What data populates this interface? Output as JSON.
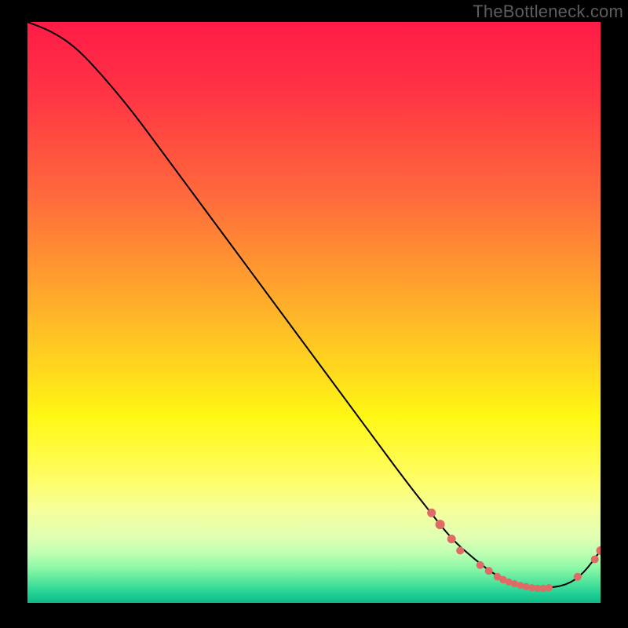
{
  "watermark": "TheBottleneck.com",
  "chart_data": {
    "type": "line",
    "title": "",
    "xlabel": "",
    "ylabel": "",
    "xlim": [
      0,
      100
    ],
    "ylim": [
      0,
      100
    ],
    "grid": false,
    "series": [
      {
        "name": "curve",
        "x": [
          0,
          4,
          8,
          12,
          18,
          24,
          30,
          36,
          42,
          48,
          54,
          60,
          66,
          70,
          74,
          78,
          82,
          86,
          90,
          94,
          97,
          100
        ],
        "y": [
          100,
          98.5,
          96,
          92,
          85,
          77,
          69,
          61,
          53,
          45,
          37,
          29,
          21,
          16,
          11,
          7.5,
          4.5,
          3,
          2.5,
          3,
          5,
          9
        ]
      }
    ],
    "markers": {
      "name": "highlight-dots",
      "color": "#e06a65",
      "points": [
        {
          "x": 70.5,
          "y": 15.5,
          "r": 5.5
        },
        {
          "x": 72.0,
          "y": 13.5,
          "r": 6.0
        },
        {
          "x": 74.0,
          "y": 11.0,
          "r": 5.5
        },
        {
          "x": 75.5,
          "y": 9.0,
          "r": 5.0
        },
        {
          "x": 79.0,
          "y": 6.5,
          "r": 5.0
        },
        {
          "x": 80.5,
          "y": 5.5,
          "r": 5.0
        },
        {
          "x": 82.0,
          "y": 4.5,
          "r": 4.8
        },
        {
          "x": 83.0,
          "y": 4.0,
          "r": 4.8
        },
        {
          "x": 84.0,
          "y": 3.6,
          "r": 4.6
        },
        {
          "x": 85.0,
          "y": 3.3,
          "r": 4.6
        },
        {
          "x": 86.0,
          "y": 3.0,
          "r": 4.6
        },
        {
          "x": 87.0,
          "y": 2.8,
          "r": 4.6
        },
        {
          "x": 88.0,
          "y": 2.6,
          "r": 4.6
        },
        {
          "x": 89.0,
          "y": 2.5,
          "r": 4.6
        },
        {
          "x": 90.0,
          "y": 2.5,
          "r": 4.6
        },
        {
          "x": 91.0,
          "y": 2.6,
          "r": 4.6
        },
        {
          "x": 96.0,
          "y": 4.5,
          "r": 5.0
        },
        {
          "x": 99.0,
          "y": 7.5,
          "r": 5.0
        },
        {
          "x": 100.0,
          "y": 9.0,
          "r": 5.5
        }
      ]
    },
    "background_gradient": {
      "stops": [
        {
          "offset": 0.0,
          "color": "#ff1b47"
        },
        {
          "offset": 0.12,
          "color": "#ff3344"
        },
        {
          "offset": 0.3,
          "color": "#ff6a3c"
        },
        {
          "offset": 0.5,
          "color": "#ffb329"
        },
        {
          "offset": 0.68,
          "color": "#fff714"
        },
        {
          "offset": 0.78,
          "color": "#fffd60"
        },
        {
          "offset": 0.84,
          "color": "#f6fe9a"
        },
        {
          "offset": 0.885,
          "color": "#e2ffb3"
        },
        {
          "offset": 0.915,
          "color": "#beffb2"
        },
        {
          "offset": 0.94,
          "color": "#8cf8a7"
        },
        {
          "offset": 0.965,
          "color": "#4fe39c"
        },
        {
          "offset": 0.985,
          "color": "#1fcf95"
        },
        {
          "offset": 1.0,
          "color": "#0fb885"
        }
      ]
    }
  }
}
